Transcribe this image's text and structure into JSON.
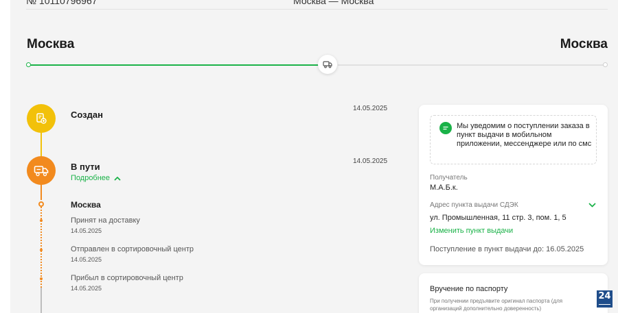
{
  "header": {
    "order_number_cut": "№ 10110796967",
    "route_cut": "Москва — Москва"
  },
  "route": {
    "from_city": "Москва",
    "to_city": "Москва",
    "progress": 0.5
  },
  "timeline": {
    "steps": [
      {
        "title": "Создан",
        "date": "14.05.2025",
        "color": "#f2c10a"
      },
      {
        "title": "В пути",
        "date": "14.05.2025",
        "color": "#f28a1e",
        "more_label": "Подробнее"
      }
    ],
    "location": "Москва",
    "events": [
      {
        "label": "Принят на доставку",
        "date": "14.05.2025"
      },
      {
        "label": "Отправлен в сортировочный центр",
        "date": "14.05.2025"
      },
      {
        "label": "Прибыл в сортировочный центр",
        "date": "14.05.2025"
      }
    ]
  },
  "info_card": {
    "notification": "Мы уведомим о поступлении заказа в пункт выдачи в мобильном приложении, мессенджере или по смс",
    "recipient_label": "Получатель",
    "recipient_value": "М.А.Б.к.",
    "address_label": "Адрес пункта выдачи СДЭК",
    "address_value": "ул. Промышленная, 11 стр. 3, пом. 1, 5",
    "change_link": "Изменить пункт выдачи",
    "arrival": "Поступление в пункт выдачи до: 16.05.2025"
  },
  "passport_card": {
    "title": "Вручение по паспорту",
    "text": "При получении предъявите оригинал паспорта (для организаций дополнительно доверенность)"
  },
  "badge": {
    "text": "24"
  },
  "colors": {
    "accent_green": "#1ab248",
    "yellow": "#f2c10a",
    "orange": "#f28a1e"
  }
}
